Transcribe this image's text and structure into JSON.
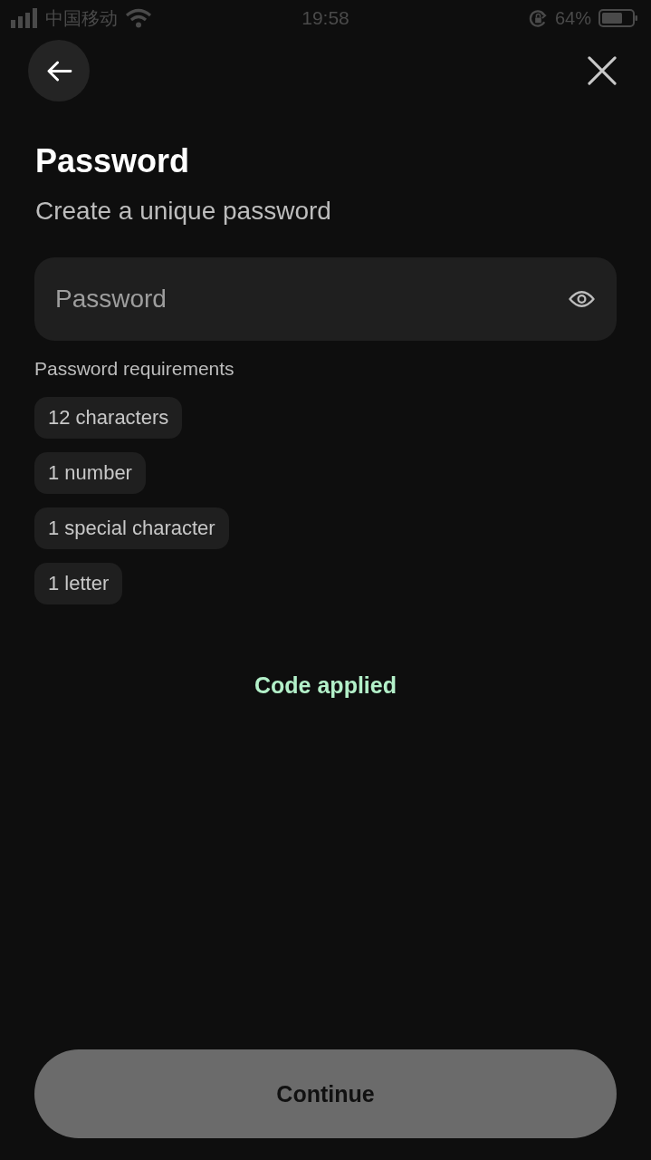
{
  "status_bar": {
    "carrier": "中国移动",
    "time": "19:58",
    "battery": "64%"
  },
  "title": "Password",
  "subtitle": "Create a unique password",
  "password_field": {
    "placeholder": "Password"
  },
  "requirements": {
    "label": "Password requirements",
    "items": [
      "12 characters",
      "1 number",
      "1 special character",
      "1 letter"
    ]
  },
  "promo_status": "Code applied",
  "continue_button": {
    "label": "Continue",
    "disabled": true
  }
}
